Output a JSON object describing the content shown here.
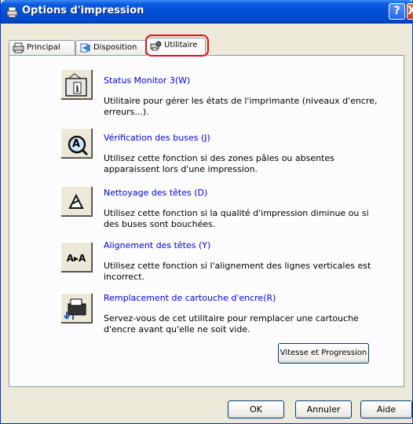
{
  "window": {
    "title": "Options d'impression",
    "help_button": "?",
    "close_button": "X"
  },
  "tabs": [
    {
      "label": "Principal"
    },
    {
      "label": "Disposition"
    },
    {
      "label": "Utilitaire"
    }
  ],
  "utilities": [
    {
      "title": "Status Monitor 3(W)",
      "description": "Utilitaire pour gérer les états de l'imprimante (niveaux d'encre, erreurs...).",
      "icon": "status-monitor-icon"
    },
    {
      "title": "Vérification des buses (J)",
      "description": "Utilisez cette fonction si des zones pâles ou absentes apparaissent lors d'une impression.",
      "icon": "nozzle-check-icon"
    },
    {
      "title": "Nettoyage des têtes (D)",
      "description": "Utilisez cette fonction si la qualité d'impression diminue ou si des buses sont bouchées.",
      "icon": "head-cleaning-icon"
    },
    {
      "title": "Alignement des têtes (Y)",
      "description": "Utilisez cette fonction si l'alignement des lignes verticales est incorrect.",
      "icon": "head-alignment-icon",
      "icon_text": "A▸A"
    },
    {
      "title": "Remplacement de cartouche d'encre(R)",
      "description": "Servez-vous de cet utilitaire pour remplacer une cartouche d'encre avant qu'elle ne soit vide.",
      "icon": "cartridge-replacement-icon"
    }
  ],
  "speed_button": "Vitesse et Progression",
  "buttons": {
    "ok": "OK",
    "cancel": "Annuler",
    "help": "Aide"
  }
}
